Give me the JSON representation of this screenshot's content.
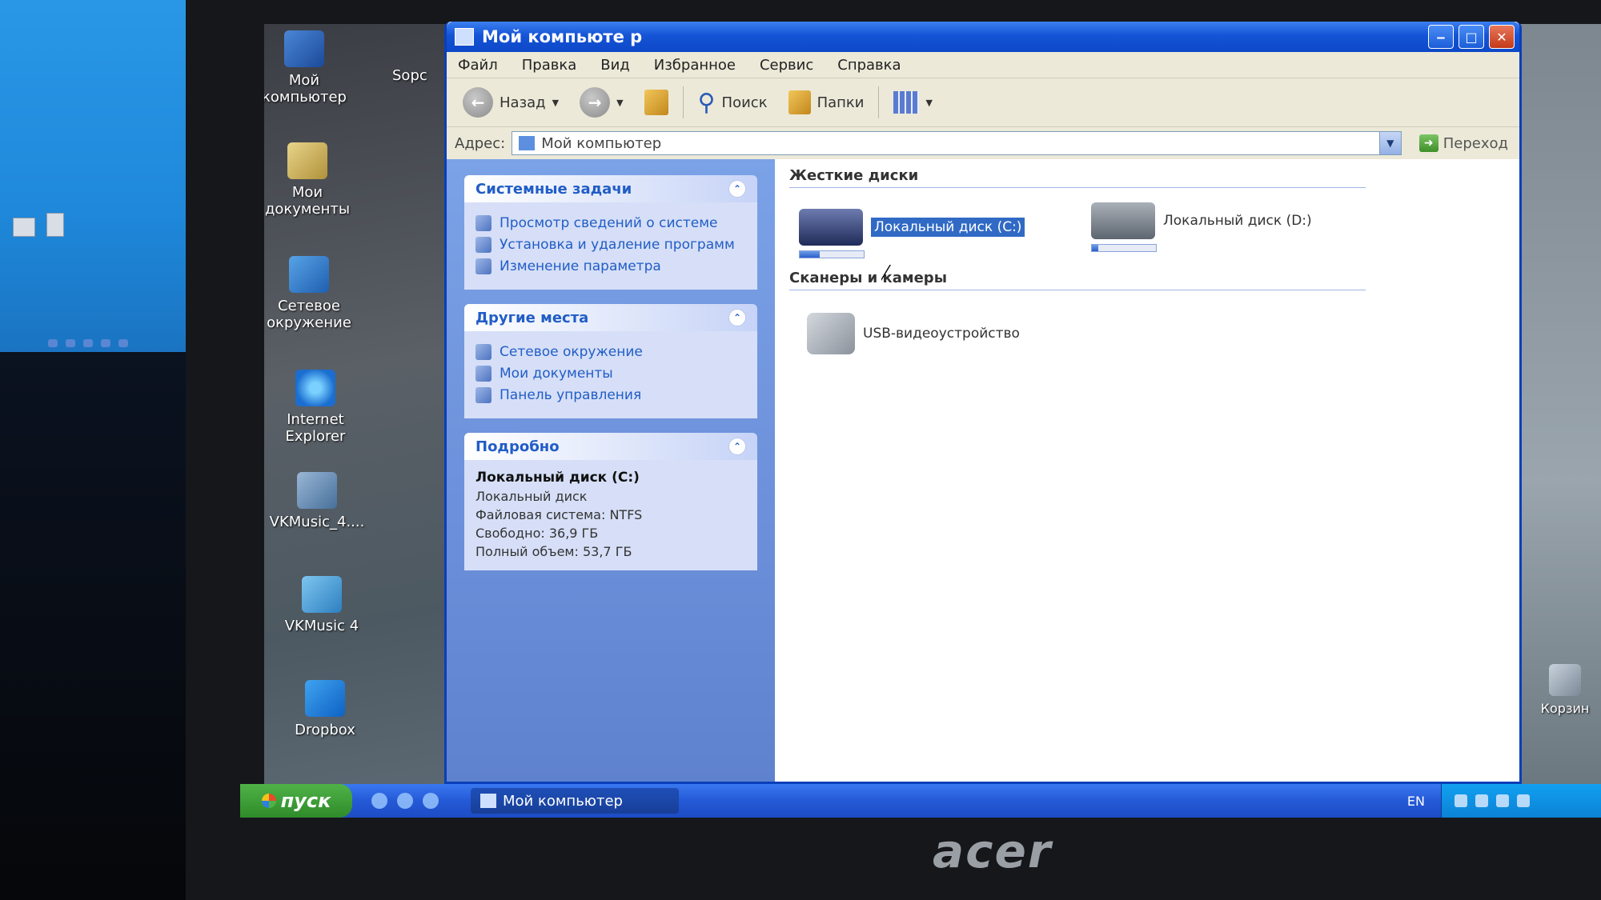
{
  "desktop": {
    "icons": [
      {
        "name": "Мой компьютер"
      },
      {
        "name": "Мои документы"
      },
      {
        "name": "Сетевое окружение"
      },
      {
        "name": "Internet Explorer"
      },
      {
        "name": "VKMusic_4...."
      },
      {
        "name": "VKMusic 4"
      },
      {
        "name": "Dropbox"
      }
    ],
    "partial_icon_label": "Sopc",
    "recycle_label": "Корзин",
    "brand": "acer"
  },
  "window": {
    "title": "Мой компьюте р",
    "menu": [
      "Файл",
      "Правка",
      "Вид",
      "Избранное",
      "Сервис",
      "Справка"
    ],
    "toolbar": {
      "back_label": "Назад",
      "search_label": "Поиск",
      "folders_label": "Папки"
    },
    "address": {
      "label": "Адрес:",
      "value": "Мой компьютер",
      "go_label": "Переход"
    },
    "taskpane": {
      "system_tasks": {
        "title": "Системные задачи",
        "links": [
          "Просмотр сведений о системе",
          "Установка и удаление программ",
          "Изменение параметра"
        ]
      },
      "other_places": {
        "title": "Другие места",
        "links": [
          "Сетевое окружение",
          "Мои документы",
          "Панель управления"
        ]
      },
      "details": {
        "title": "Подробно",
        "name": "Локальный диск (C:)",
        "type": "Локальный диск",
        "fs": "Файловая система: NTFS",
        "free": "Свободно: 36,9 ГБ",
        "total": "Полный объем: 53,7 ГБ"
      }
    },
    "content": {
      "hard_drives_title": "Жесткие диски",
      "drives": [
        {
          "label": "Локальный диск (C:)",
          "used_fraction": 0.31,
          "selected": true
        },
        {
          "label": "Локальный диск (D:)",
          "used_fraction": 0.1,
          "selected": false
        }
      ],
      "scanners_title": "Сканеры и камеры",
      "devices": [
        {
          "label": "USB-видеоустройство"
        }
      ]
    }
  },
  "taskbar": {
    "start_label": "пуск",
    "task_label": "Мой компьютер",
    "lang": "EN"
  },
  "colors": {
    "titlebar": "#0d48c8",
    "taskpane": "#6b8fd9",
    "start": "#2f8b2a",
    "selection": "#316ac5"
  }
}
